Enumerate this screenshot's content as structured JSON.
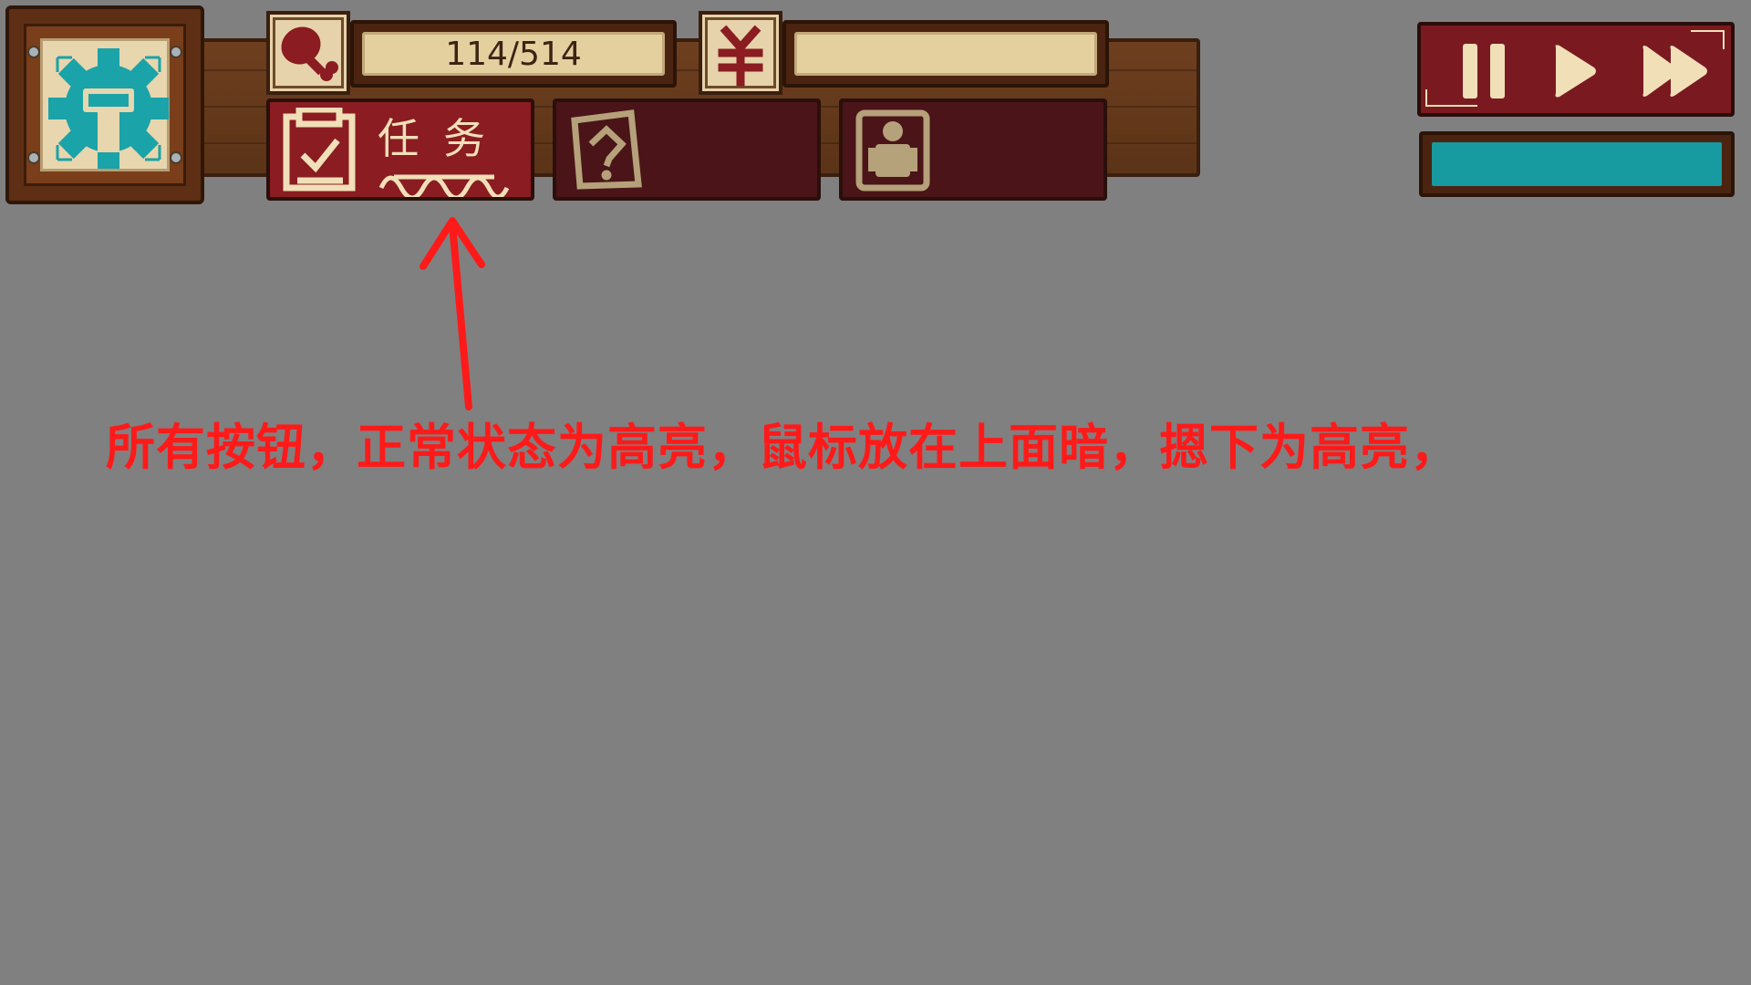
{
  "hud": {
    "settings": {
      "icon": "gear-icon"
    },
    "food": {
      "icon": "meat-drumstick-icon",
      "value": "114/514"
    },
    "money": {
      "icon": "yuan-currency-icon",
      "value": ""
    }
  },
  "tabs": [
    {
      "icon": "clipboard-check-icon",
      "label": "任务",
      "state": "highlighted"
    },
    {
      "icon": "question-rune-icon",
      "label": "",
      "state": "normal"
    },
    {
      "icon": "character-figure-icon",
      "label": "",
      "state": "normal"
    }
  ],
  "speed_controls": {
    "buttons": [
      "pause-icon",
      "play-icon",
      "fast-forward-icon"
    ],
    "progress_fraction": 1.0
  },
  "annotation": {
    "text": "所有按钮，正常状态为高亮，鼠标放在上面暗，摁下为高亮，"
  },
  "colors": {
    "background": "#808080",
    "tab_active": "#8a1c22",
    "tab_inactive": "#4a1418",
    "accent_teal": "#179aa0",
    "annotation_red": "#ff1a1a",
    "parchment": "#e4cf9f"
  }
}
